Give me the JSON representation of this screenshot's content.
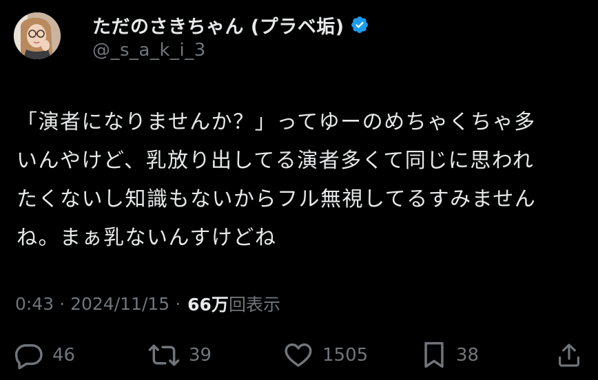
{
  "user": {
    "display_name": "ただのさきちゃん (プラベ垢)",
    "handle": "@_s_a_k_i_3",
    "verified": true,
    "verified_color": "#1d9bf0"
  },
  "tweet": {
    "lines": [
      "「演者になりませんか？」ってゆーのめちゃくちゃ多",
      "いんやけど、乳放り出してる演者多くて同じに思われ",
      "たくないし知識もないからフル無視してるすみません",
      "ね。まぁ乳ないんすけどね"
    ]
  },
  "meta": {
    "time": "0:43",
    "separator": "·",
    "date": "2024/11/15",
    "views_count": "66万",
    "views_label": "回表示"
  },
  "actions": {
    "reply": {
      "icon": "reply-icon",
      "count": "46"
    },
    "retweet": {
      "icon": "retweet-icon",
      "count": "39"
    },
    "like": {
      "icon": "heart-icon",
      "count": "1505"
    },
    "bookmark": {
      "icon": "bookmark-icon",
      "count": "38"
    },
    "share": {
      "icon": "share-icon"
    }
  }
}
